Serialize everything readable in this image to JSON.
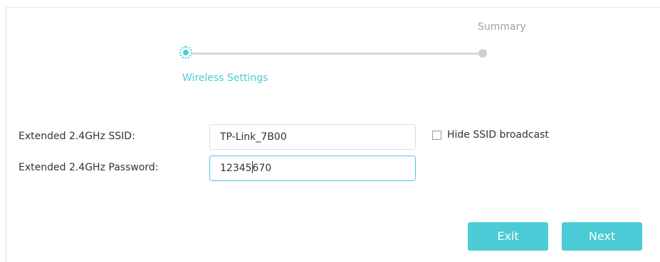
{
  "stepper": {
    "steps": [
      {
        "label": "Wireless Settings",
        "state": "active"
      },
      {
        "label": "Summary",
        "state": "pending"
      }
    ]
  },
  "form": {
    "ssid": {
      "label": "Extended 2.4GHz SSID:",
      "value": "TP-Link_7B00"
    },
    "password": {
      "label": "Extended 2.4GHz Password:",
      "value_before_caret": "12345",
      "value_after_caret": "670"
    },
    "hide_ssid": {
      "label": "Hide SSID broadcast",
      "checked": false
    }
  },
  "buttons": {
    "exit_label": "Exit",
    "next_label": "Next"
  },
  "colors": {
    "accent": "#4acbd6",
    "inactive": "#cfcfcf",
    "text": "#333333"
  }
}
